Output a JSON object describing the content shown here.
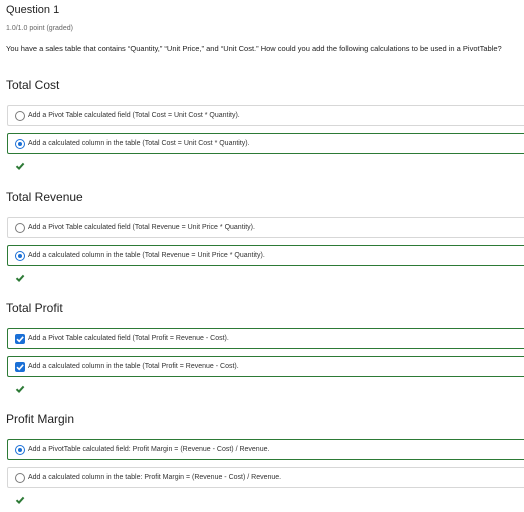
{
  "question": {
    "title": "Question 1",
    "points": "1.0/1.0 point (graded)",
    "prompt": "You have a sales table that contains “Quantity,” “Unit Price,” and “Unit Cost.” How could you add the following calculations to be used in a PivotTable?"
  },
  "sections": [
    {
      "title": "Total Cost",
      "input_type": "radio",
      "options": [
        {
          "label": "Add a Pivot Table calculated field (Total Cost = Unit Cost * Quantity).",
          "selected": false
        },
        {
          "label": "Add a calculated column in the table (Total Cost = Unit Cost * Quantity).",
          "selected": true
        }
      ],
      "result": "correct"
    },
    {
      "title": "Total Revenue",
      "input_type": "radio",
      "options": [
        {
          "label": "Add a Pivot Table calculated field (Total Revenue = Unit Price * Quantity).",
          "selected": false
        },
        {
          "label": "Add a calculated column in the table (Total Revenue = Unit Price * Quantity).",
          "selected": true
        }
      ],
      "result": "correct"
    },
    {
      "title": "Total Profit",
      "input_type": "checkbox",
      "options": [
        {
          "label": "Add a Pivot Table calculated field (Total Profit = Revenue - Cost).",
          "selected": true
        },
        {
          "label": "Add a calculated column in the table (Total Profit = Revenue - Cost).",
          "selected": true
        }
      ],
      "result": "correct"
    },
    {
      "title": "Profit Margin",
      "input_type": "radio",
      "options": [
        {
          "label": "Add a PivotTable calculated field: Profit Margin = (Revenue - Cost) / Revenue.",
          "selected": true
        },
        {
          "label": "Add a calculated column in the table: Profit Margin = (Revenue - Cost) / Revenue.",
          "selected": false
        }
      ],
      "result": "correct"
    }
  ],
  "colors": {
    "correct": "#2d7a36",
    "selected_control": "#1a6fd6",
    "border": "#d7d7d7"
  },
  "icons": {
    "correct": "check-icon"
  }
}
